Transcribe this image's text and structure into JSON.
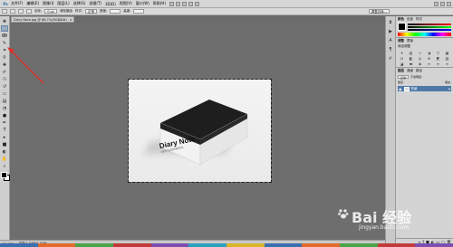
{
  "menubar": {
    "logo": "Ps",
    "items": [
      "文件(F)",
      "编辑(E)",
      "图像(I)",
      "图层(L)",
      "选择(S)",
      "滤镜(T)",
      "3D(D)",
      "视图(V)",
      "窗口(W)",
      "帮助(H)"
    ]
  },
  "options": {
    "feather_label": "羽化:",
    "feather_value": "0 px",
    "antialias_label": "消除锯齿",
    "style_label": "样式:",
    "style_value": "正常",
    "width_label": "宽度:",
    "height_label": "高度:",
    "refine_label": "调整边缘..."
  },
  "document": {
    "tab_title": "Diary Note.jpg @ 66.7%(RGB/8#)"
  },
  "status": {
    "zoom": "66.67%",
    "info": "文档:1.04M/1.04M"
  },
  "photo": {
    "box_title": "Diary Note",
    "box_subtitle": "with GUIDEBOOK"
  },
  "panels": {
    "color": {
      "tabs": [
        "颜色",
        "色板",
        "样式"
      ]
    },
    "adjustments": {
      "tabs": [
        "调整",
        "蒙版"
      ],
      "title": "添加调整"
    },
    "layers": {
      "tabs": [
        "图层",
        "通道",
        "路径"
      ],
      "blend_mode": "正常",
      "opacity": "不透明度:",
      "lock_label": "锁定:",
      "fill": "填充:",
      "layer_name": "背景"
    }
  },
  "watermark": {
    "brand": "Bai 经验",
    "url": "jingyan.baidu.com"
  },
  "colors": {
    "annotation_red": "#e0302a",
    "selected_layer": "#4f78a9"
  }
}
